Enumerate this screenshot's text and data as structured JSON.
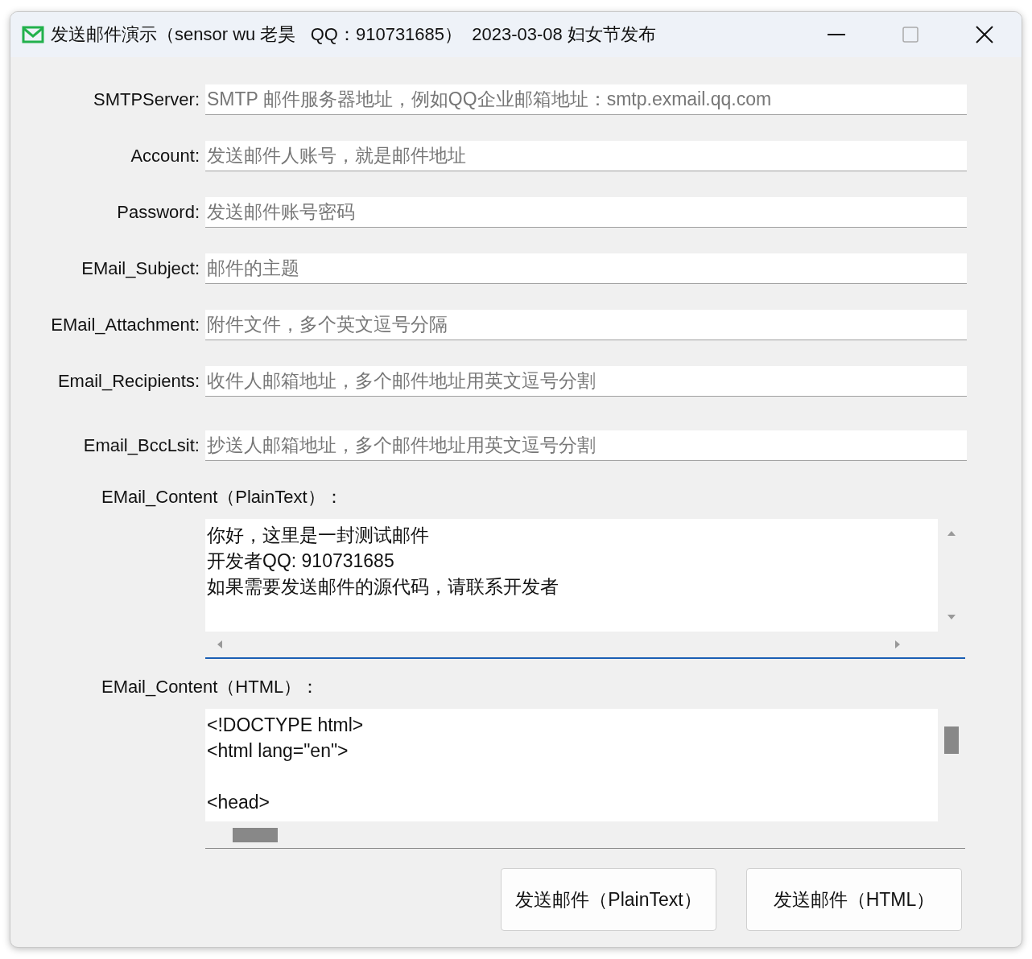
{
  "window": {
    "title": "发送邮件演示（sensor wu 老昊   QQ：910731685）  2023-03-08 妇女节发布"
  },
  "fields": [
    {
      "label": "SMTPServer:",
      "placeholder": "SMTP 邮件服务器地址，例如QQ企业邮箱地址：smtp.exmail.qq.com"
    },
    {
      "label": "Account:",
      "placeholder": "发送邮件人账号，就是邮件地址"
    },
    {
      "label": "Password:",
      "placeholder": "发送邮件账号密码"
    },
    {
      "label": "EMail_Subject:",
      "placeholder": "邮件的主题"
    },
    {
      "label": "EMail_Attachment:",
      "placeholder": "附件文件，多个英文逗号分隔"
    },
    {
      "label": "Email_Recipients:",
      "placeholder": "收件人邮箱地址，多个邮件地址用英文逗号分割"
    },
    {
      "label": "Email_BccLsit:",
      "placeholder": "抄送人邮箱地址，多个邮件地址用英文逗号分割"
    }
  ],
  "contents": [
    {
      "label": "EMail_Content（PlainText）：",
      "lines": [
        {
          "text": "你好，这里是一封测试邮件",
          "blank_before": false
        },
        {
          "text": "开发者QQ: 910731685",
          "blank_before": false
        },
        {
          "text": "如果需要发送邮件的源代码，请联系开发者",
          "blank_before": false
        }
      ],
      "focused": true,
      "scrolled": false
    },
    {
      "label": "EMail_Content（HTML）：",
      "lines": [
        {
          "text": "<!DOCTYPE html>",
          "blank_before": false
        },
        {
          "text": "<html lang=\"en\">",
          "blank_before": false
        },
        {
          "text": "<head>",
          "blank_before": true
        }
      ],
      "focused": false,
      "scrolled": true
    }
  ],
  "buttons": [
    "发送邮件（PlainText）",
    "发送邮件（HTML）"
  ]
}
